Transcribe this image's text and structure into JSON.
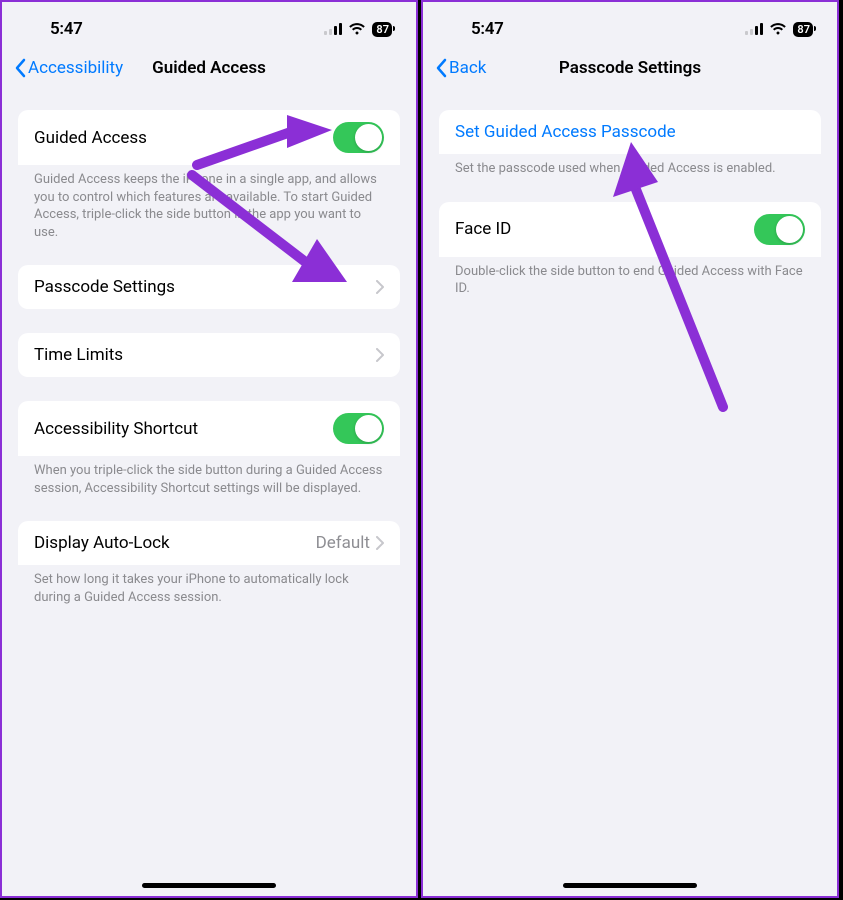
{
  "status": {
    "time": "5:47",
    "battery": "87"
  },
  "left": {
    "nav": {
      "back": "Accessibility",
      "title": "Guided Access"
    },
    "groups": [
      {
        "rows": [
          {
            "label": "Guided Access",
            "toggle": true
          }
        ],
        "footer": "Guided Access keeps the iPhone in a single app, and allows you to control which features are available. To start Guided Access, triple-click the side button in the app you want to use."
      },
      {
        "rows": [
          {
            "label": "Passcode Settings"
          }
        ]
      },
      {
        "rows": [
          {
            "label": "Time Limits"
          }
        ]
      },
      {
        "rows": [
          {
            "label": "Accessibility Shortcut",
            "toggle": true
          }
        ],
        "footer": "When you triple-click the side button during a Guided Access session, Accessibility Shortcut settings will be displayed."
      },
      {
        "rows": [
          {
            "label": "Display Auto-Lock",
            "value": "Default"
          }
        ],
        "footer": "Set how long it takes your iPhone to automatically lock during a Guided Access session."
      }
    ]
  },
  "right": {
    "nav": {
      "back": "Back",
      "title": "Passcode Settings"
    },
    "groups": [
      {
        "rows": [
          {
            "label": "Set Guided Access Passcode",
            "link": true
          }
        ],
        "footer": "Set the passcode used when Guided Access is enabled."
      },
      {
        "rows": [
          {
            "label": "Face ID",
            "toggle": true
          }
        ],
        "footer": "Double-click the side button to end Guided Access with Face ID."
      }
    ]
  }
}
